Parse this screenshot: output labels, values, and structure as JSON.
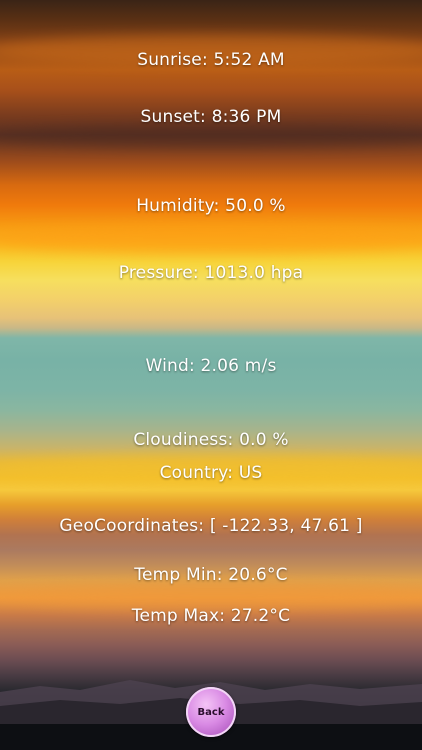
{
  "weather": {
    "sunrise": "Sunrise: 5:52 AM",
    "sunset": "Sunset: 8:36 PM",
    "humidity": "Humidity: 50.0 %",
    "pressure": "Pressure: 1013.0 hpa",
    "wind": "Wind: 2.06 m/s",
    "cloudiness": "Cloudiness: 0.0 %",
    "country": "Country: US",
    "geocoordinates": "GeoCoordinates: [ -122.33, 47.61 ]",
    "temp_min": "Temp Min: 20.6°C",
    "temp_max": "Temp Max: 27.2°C"
  },
  "navigation": {
    "back_label": "Back"
  },
  "colors": {
    "text": "#ffffff",
    "back_button": "#d98ae4"
  }
}
